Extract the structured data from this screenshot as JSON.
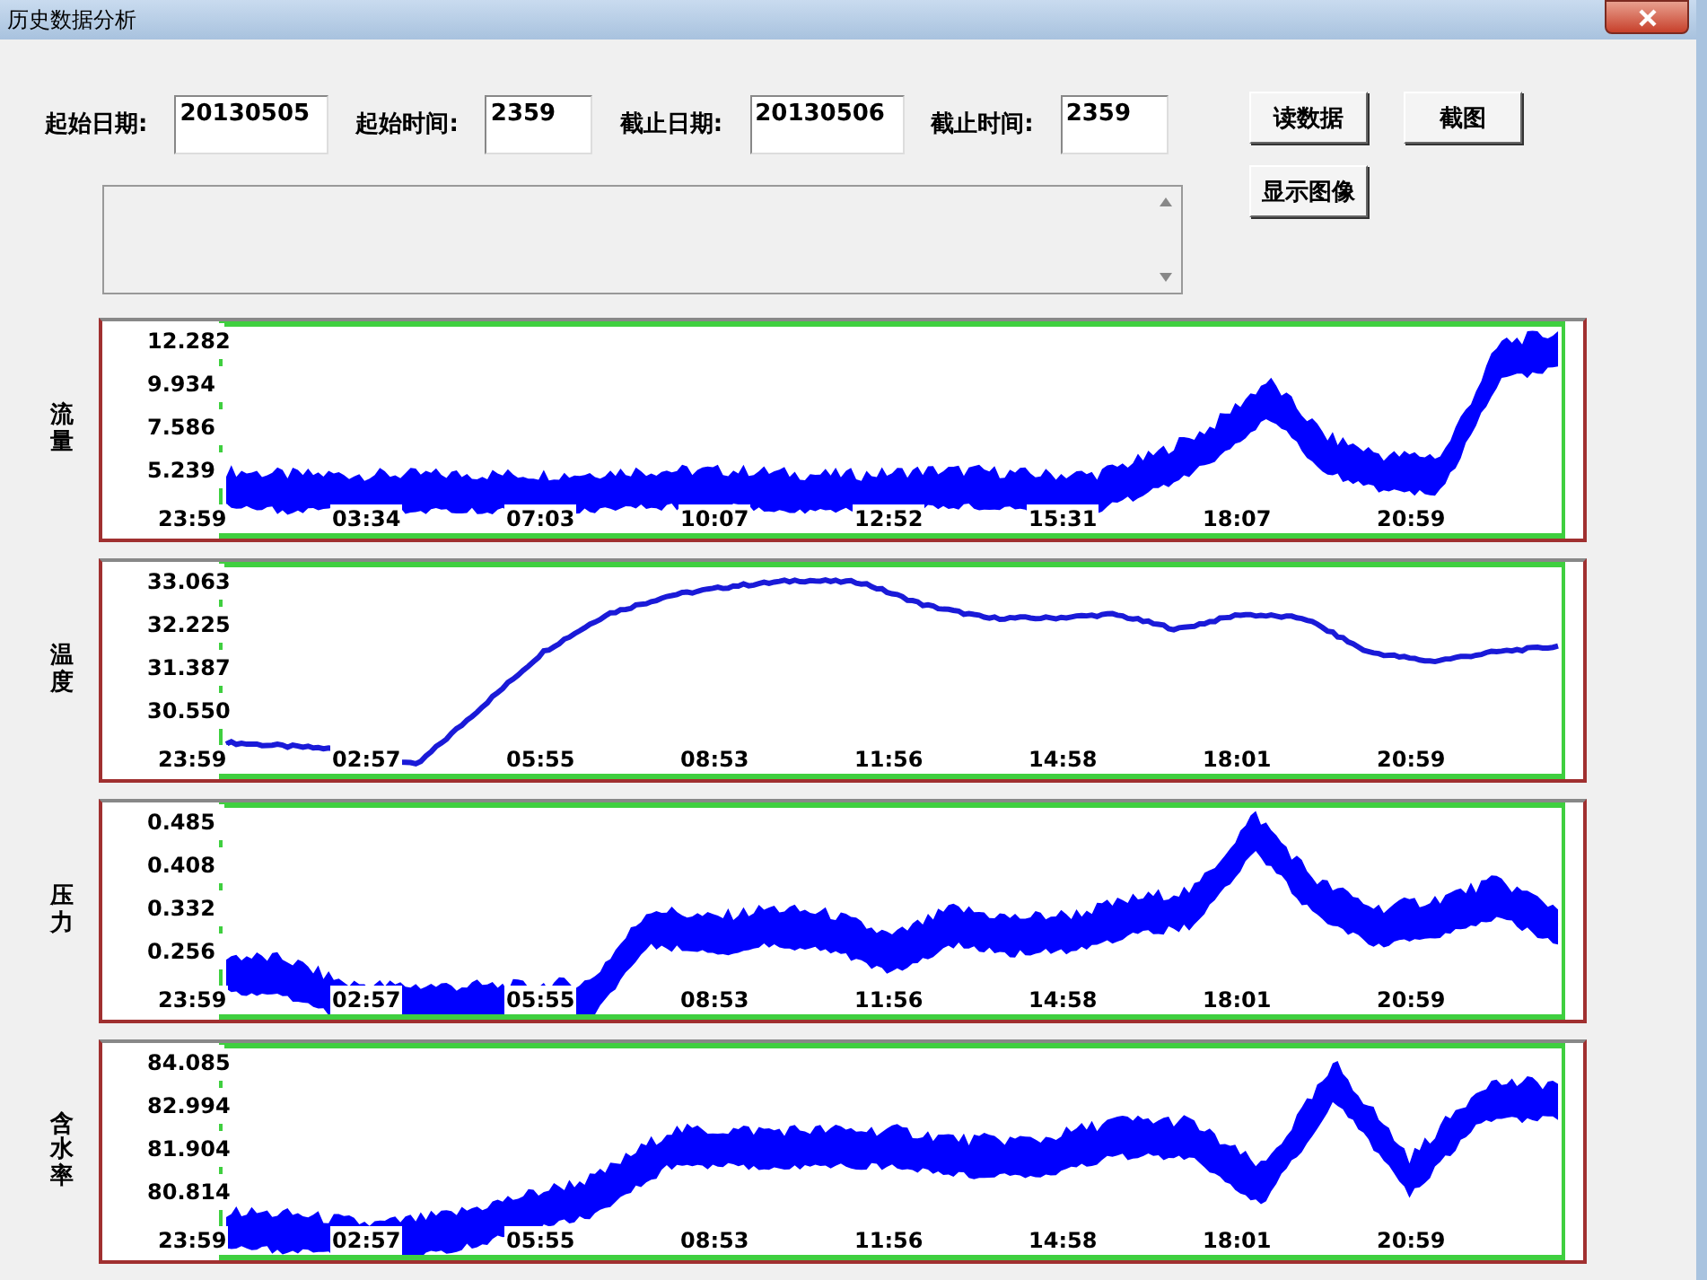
{
  "window": {
    "title": "历史数据分析"
  },
  "query": {
    "fields": [
      {
        "label": "起始日期:",
        "value": "20130505",
        "kind": "date"
      },
      {
        "label": "起始时间:",
        "value": "2359",
        "kind": "time"
      },
      {
        "label": "截止日期:",
        "value": "20130506",
        "kind": "date"
      },
      {
        "label": "截止时间:",
        "value": "2359",
        "kind": "time"
      }
    ],
    "buttons": [
      "读数据",
      "截图",
      "显示图像"
    ]
  },
  "charts": [
    {
      "label": "流量",
      "kind": "band",
      "y_ticks": [
        "12.282",
        "9.934",
        "7.586",
        "5.239"
      ],
      "x_ticks": [
        "23:59",
        "03:34",
        "07:03",
        "10:07",
        "12:52",
        "15:31",
        "18:07",
        "20:59"
      ]
    },
    {
      "label": "温度",
      "kind": "line",
      "y_ticks": [
        "33.063",
        "32.225",
        "31.387",
        "30.550"
      ],
      "x_ticks": [
        "23:59",
        "02:57",
        "05:55",
        "08:53",
        "11:56",
        "14:58",
        "18:01",
        "20:59"
      ]
    },
    {
      "label": "压力",
      "kind": "band",
      "y_ticks": [
        "0.485",
        "0.408",
        "0.332",
        "0.256"
      ],
      "x_ticks": [
        "23:59",
        "02:57",
        "05:55",
        "08:53",
        "11:56",
        "14:58",
        "18:01",
        "20:59"
      ]
    },
    {
      "label": "含水率",
      "kind": "band",
      "y_ticks": [
        "84.085",
        "82.994",
        "81.904",
        "80.814"
      ],
      "x_ticks": [
        "23:59",
        "02:57",
        "05:55",
        "08:53",
        "11:56",
        "14:58",
        "18:01",
        "20:59"
      ]
    }
  ]
}
